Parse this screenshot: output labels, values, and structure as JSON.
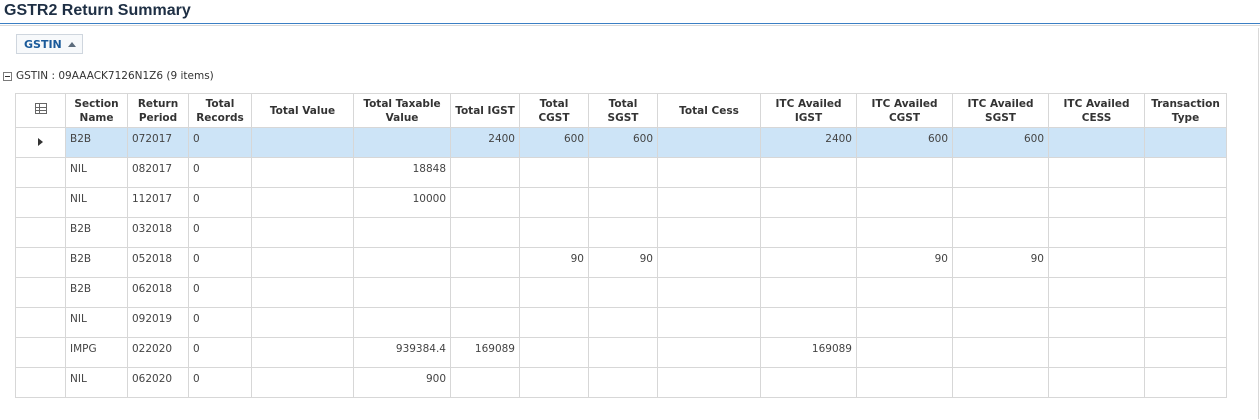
{
  "page": {
    "title": "GSTR2 Return Summary"
  },
  "group_panel": {
    "button_label": "GSTIN"
  },
  "group": {
    "label": "GSTIN : 09AAACK7126N1Z6 (9 items)"
  },
  "columns": [
    "Section Name",
    "Return Period",
    "Total Records",
    "Total Value",
    "Total Taxable Value",
    "Total IGST",
    "Total CGST",
    "Total SGST",
    "Total Cess",
    "ITC Availed IGST",
    "ITC Availed CGST",
    "ITC Availed SGST",
    "ITC Availed CESS",
    "Transaction Type"
  ],
  "selected_row": 0,
  "rows": [
    [
      "B2B",
      "072017",
      "0",
      "",
      "",
      "2400",
      "600",
      "600",
      "",
      "2400",
      "600",
      "600",
      "",
      ""
    ],
    [
      "NIL",
      "082017",
      "0",
      "",
      "18848",
      "",
      "",
      "",
      "",
      "",
      "",
      "",
      "",
      ""
    ],
    [
      "NIL",
      "112017",
      "0",
      "",
      "10000",
      "",
      "",
      "",
      "",
      "",
      "",
      "",
      "",
      ""
    ],
    [
      "B2B",
      "032018",
      "0",
      "",
      "",
      "",
      "",
      "",
      "",
      "",
      "",
      "",
      "",
      ""
    ],
    [
      "B2B",
      "052018",
      "0",
      "",
      "",
      "",
      "90",
      "90",
      "",
      "",
      "90",
      "90",
      "",
      ""
    ],
    [
      "B2B",
      "062018",
      "0",
      "",
      "",
      "",
      "",
      "",
      "",
      "",
      "",
      "",
      "",
      ""
    ],
    [
      "NIL",
      "092019",
      "0",
      "",
      "",
      "",
      "",
      "",
      "",
      "",
      "",
      "",
      "",
      ""
    ],
    [
      "IMPG",
      "022020",
      "0",
      "",
      "939384.4",
      "169089",
      "",
      "",
      "",
      "169089",
      "",
      "",
      "",
      ""
    ],
    [
      "NIL",
      "062020",
      "0",
      "",
      "900",
      "",
      "",
      "",
      "",
      "",
      "",
      "",
      "",
      ""
    ]
  ],
  "icons": {
    "group_toggle": "collapse-minus-icon",
    "column_chooser": "column-chooser-icon",
    "row_indicator": "row-indicator-arrow-icon",
    "sort": "sort-ascending-icon"
  }
}
